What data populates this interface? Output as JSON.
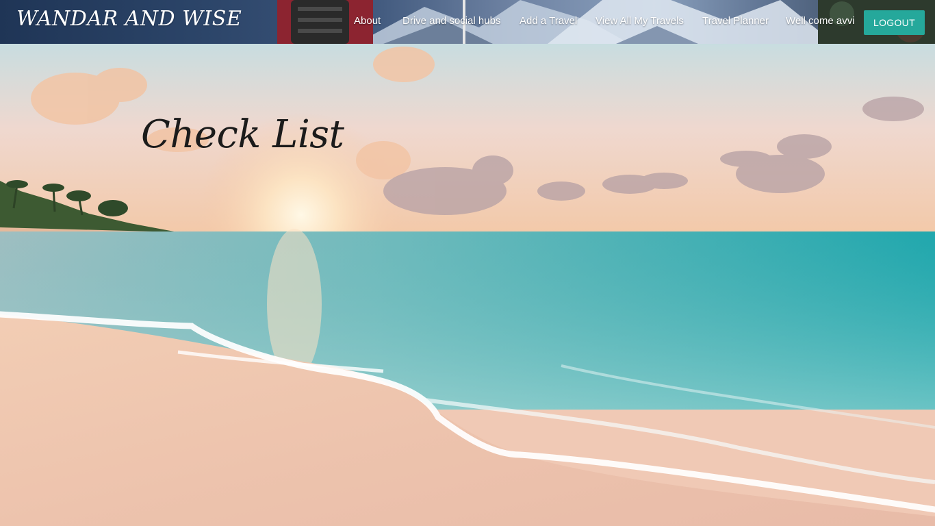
{
  "brand": {
    "name": "WANDAR AND WISE"
  },
  "nav": {
    "items": [
      {
        "label": "About"
      },
      {
        "label": "Drive and social hubs"
      },
      {
        "label": "Add a Travel"
      },
      {
        "label": "View All My Travels"
      },
      {
        "label": "Travel Planner"
      },
      {
        "label": "Well come avvi"
      }
    ],
    "logout_label": "LOGOUT"
  },
  "page": {
    "title": "Check List"
  },
  "colors": {
    "accent": "#25a89b",
    "title": "#1b1b1b"
  }
}
